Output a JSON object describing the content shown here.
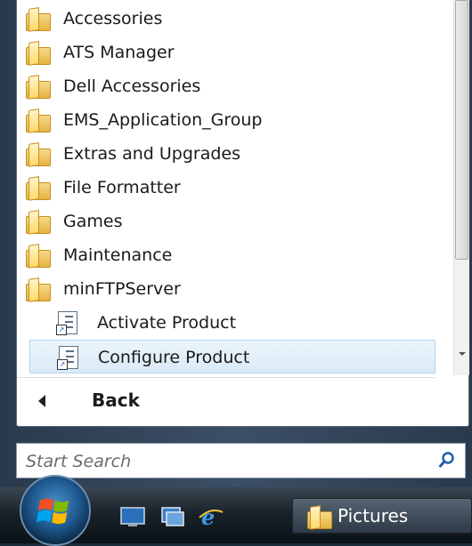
{
  "programs": {
    "items": [
      {
        "label": "Accessories",
        "icon": "folder-icon",
        "kind": "folder"
      },
      {
        "label": "ATS Manager",
        "icon": "folder-icon",
        "kind": "folder"
      },
      {
        "label": "Dell Accessories",
        "icon": "folder-icon",
        "kind": "folder"
      },
      {
        "label": "EMS_Application_Group",
        "icon": "folder-icon",
        "kind": "folder"
      },
      {
        "label": "Extras and Upgrades",
        "icon": "folder-icon",
        "kind": "folder"
      },
      {
        "label": "File Formatter",
        "icon": "folder-icon",
        "kind": "folder"
      },
      {
        "label": "Games",
        "icon": "folder-icon",
        "kind": "folder"
      },
      {
        "label": "Maintenance",
        "icon": "folder-icon",
        "kind": "folder"
      },
      {
        "label": "minFTPServer",
        "icon": "folder-icon",
        "kind": "folder"
      },
      {
        "label": "Activate Product",
        "icon": "program-shortcut-icon",
        "kind": "program"
      },
      {
        "label": "Configure Product",
        "icon": "program-shortcut-icon",
        "kind": "program",
        "selected": true
      }
    ]
  },
  "back": {
    "label": "Back"
  },
  "search": {
    "placeholder": "Start Search"
  },
  "taskbar": {
    "active_window": {
      "label": "Pictures"
    }
  },
  "colors": {
    "selection_bg": "#dbeaf7",
    "selection_border": "#b6d3ea",
    "folder": "#e6b441"
  }
}
